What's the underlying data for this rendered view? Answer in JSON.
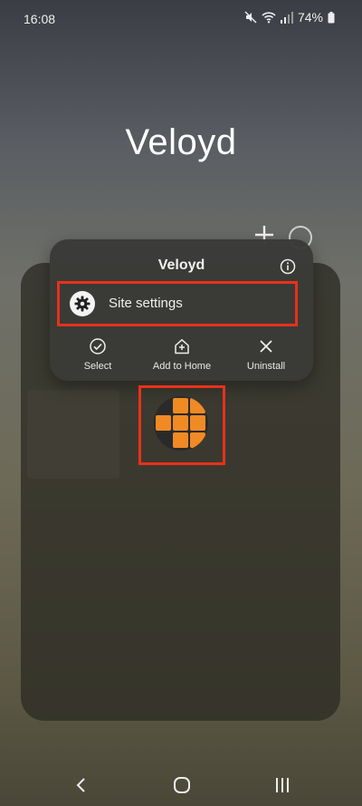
{
  "status_bar": {
    "time": "16:08",
    "battery": "74%",
    "icons": [
      "mute-icon",
      "wifi-icon",
      "signal-icon",
      "battery-icon"
    ]
  },
  "folder": {
    "title": "Veloyd"
  },
  "context_menu": {
    "title": "Veloyd",
    "site_settings_label": "Site settings",
    "actions": [
      {
        "label": "Select",
        "icon": "check-circle-icon"
      },
      {
        "label": "Add to Home",
        "icon": "add-home-icon"
      },
      {
        "label": "Uninstall",
        "icon": "close-icon"
      }
    ]
  },
  "app": {
    "name": "Veloyd",
    "icon": "orange-grid-icon"
  },
  "nav_bar": {
    "items": [
      "back-icon",
      "home-icon",
      "recents-icon"
    ]
  },
  "colors": {
    "highlight": "#e8311a",
    "app_accent": "#f08a24",
    "menu_bg": "#3a3a38"
  }
}
